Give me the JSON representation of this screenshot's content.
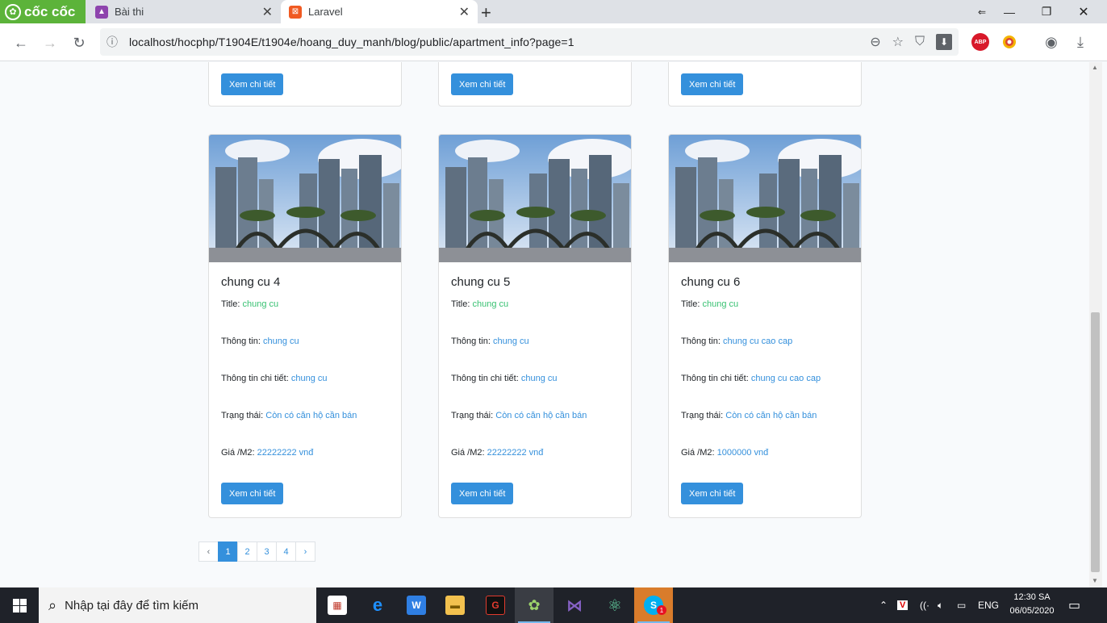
{
  "browser": {
    "brand": "cốc cốc",
    "tabs": [
      {
        "title": "Bài thi",
        "active": false
      },
      {
        "title": "Laravel",
        "active": true
      }
    ],
    "url": "localhost/hocphp/T1904E/t1904e/hoang_duy_manh/blog/public/apartment_info?page=1",
    "extensions": {
      "abp": "ABP"
    }
  },
  "top_row": {
    "buttons": [
      "Xem chi tiết",
      "Xem chi tiết",
      "Xem chi tiết"
    ]
  },
  "cards": [
    {
      "name": "chung cu 4",
      "title_label": "Title:",
      "title": "chung cu",
      "info_label": "Thông tin:",
      "info": "chung cu",
      "detail_label": "Thông tin chi tiết:",
      "detail": "chung cu",
      "status_label": "Trạng thái:",
      "status": "Còn có căn hộ cần bán",
      "price_label": "Giá /M2:",
      "price": "22222222 vnđ",
      "button": "Xem chi tiết"
    },
    {
      "name": "chung cu 5",
      "title_label": "Title:",
      "title": "chung cu",
      "info_label": "Thông tin:",
      "info": "chung cu",
      "detail_label": "Thông tin chi tiết:",
      "detail": "chung cu",
      "status_label": "Trạng thái:",
      "status": "Còn có căn hộ cần bán",
      "price_label": "Giá /M2:",
      "price": "22222222 vnđ",
      "button": "Xem chi tiết"
    },
    {
      "name": "chung cu 6",
      "title_label": "Title:",
      "title": "chung cu",
      "info_label": "Thông tin:",
      "info": "chung cu cao cap",
      "detail_label": "Thông tin chi tiết:",
      "detail": "chung cu cao cap",
      "status_label": "Trạng thái:",
      "status": "Còn có căn hộ cần bán",
      "price_label": "Giá /M2:",
      "price": "1000000 vnđ",
      "button": "Xem chi tiết"
    }
  ],
  "pagination": {
    "prev": "‹",
    "pages": [
      "1",
      "2",
      "3",
      "4"
    ],
    "active": "1",
    "next": "›"
  },
  "taskbar": {
    "search_placeholder": "Nhập tại đây để tìm kiếm",
    "language": "ENG",
    "time": "12:30 SA",
    "date": "06/05/2020",
    "notification_badge": "1"
  }
}
